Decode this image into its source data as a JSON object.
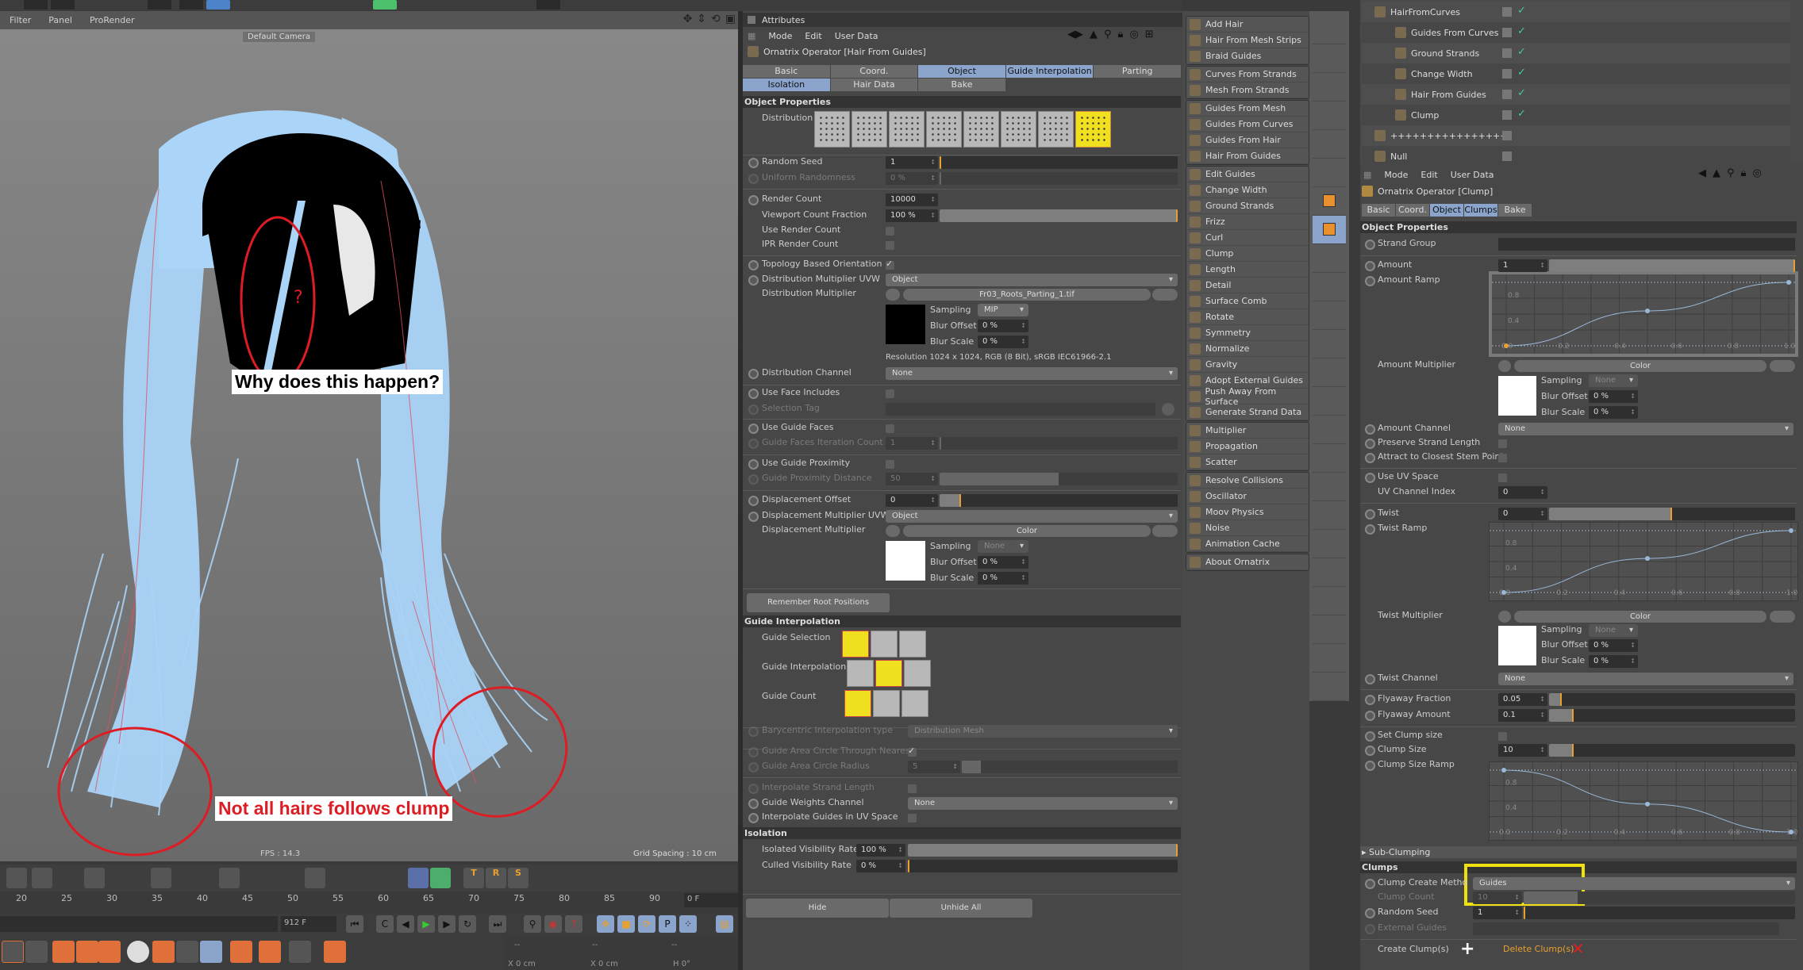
{
  "viewport": {
    "menu": [
      "Filter",
      "Panel",
      "ProRender"
    ],
    "camera_label": "Default Camera",
    "fps": "FPS : 14.3",
    "grid_spacing": "Grid Spacing : 10 cm",
    "annotation_top": "Why does this happen?",
    "annotation_bottom": "Not all hairs follows clump",
    "annotation_question": "?"
  },
  "timeline": {
    "ticks": [
      "20",
      "25",
      "30",
      "35",
      "40",
      "45",
      "50",
      "55",
      "60",
      "65",
      "70",
      "75",
      "80",
      "85",
      "90"
    ],
    "current_frame": "0 F",
    "end_frame": "912 F"
  },
  "coords": {
    "x1": "X  0 cm",
    "x2": "X  0 cm",
    "h": "H  0°",
    "dashes": "--"
  },
  "attributes_left": {
    "title": "Attributes",
    "menu": [
      "Mode",
      "Edit",
      "User Data"
    ],
    "operator": "Ornatrix Operator [Hair From Guides]",
    "tabs_row1": [
      {
        "label": "Basic",
        "active": false
      },
      {
        "label": "Coord.",
        "active": false
      },
      {
        "label": "Object",
        "active": true
      },
      {
        "label": "Guide Interpolation",
        "active": true
      },
      {
        "label": "Parting",
        "active": false
      }
    ],
    "tabs_row2": [
      {
        "label": "Isolation",
        "active": true
      },
      {
        "label": "Hair Data",
        "active": false
      },
      {
        "label": "Bake",
        "active": false
      }
    ],
    "section_object": "Object Properties",
    "distribution_label": "Distribution",
    "distribution_selected_index": 7,
    "random_seed": {
      "label": "Random Seed",
      "value": "1"
    },
    "uniform_randomness": {
      "label": "Uniform Randomness",
      "value": "0 %"
    },
    "render_count": {
      "label": "Render Count",
      "value": "10000"
    },
    "viewport_count_fraction": {
      "label": "Viewport Count Fraction",
      "value": "100 %",
      "fraction": 1.0
    },
    "use_render_count": {
      "label": "Use Render Count",
      "checked": false
    },
    "ipr_render_count": {
      "label": "IPR Render Count",
      "checked": false
    },
    "topology_orientation": {
      "label": "Topology Based Orientation",
      "checked": true
    },
    "dist_mult_uvw": {
      "label": "Distribution Multiplier UVW",
      "value": "Object"
    },
    "dist_mult": {
      "label": "Distribution Multiplier",
      "file": "Fr03_Roots_Parting_1.tif"
    },
    "dist_sampling": {
      "label": "Sampling",
      "value": "MIP"
    },
    "dist_blur_offset": {
      "label": "Blur Offset",
      "value": "0 %"
    },
    "dist_blur_scale": {
      "label": "Blur Scale",
      "value": "0 %"
    },
    "resolution": "Resolution 1024 x 1024, RGB (8 Bit), sRGB IEC61966-2.1",
    "dist_channel": {
      "label": "Distribution Channel",
      "value": "None"
    },
    "use_face_includes": {
      "label": "Use Face Includes",
      "checked": false
    },
    "selection_tag": {
      "label": "Selection Tag"
    },
    "use_guide_faces": {
      "label": "Use Guide Faces",
      "checked": false
    },
    "guide_faces_iter": {
      "label": "Guide Faces Iteration Count",
      "value": "1"
    },
    "use_guide_proximity": {
      "label": "Use Guide Proximity",
      "checked": false
    },
    "guide_proximity_distance": {
      "label": "Guide Proximity Distance",
      "value": "50",
      "fraction": 0.5
    },
    "displacement_offset": {
      "label": "Displacement Offset",
      "value": "0",
      "fraction": 0.09
    },
    "disp_mult_uvw": {
      "label": "Displacement Multiplier UVW",
      "value": "Object"
    },
    "disp_mult": {
      "label": "Displacement Multiplier",
      "value": "Color"
    },
    "disp_sampling": {
      "label": "Sampling",
      "value": "None"
    },
    "disp_blur_offset": {
      "label": "Blur Offset",
      "value": "0 %"
    },
    "disp_blur_scale": {
      "label": "Blur Scale",
      "value": "0 %"
    },
    "remember_roots": "Remember Root Positions",
    "section_guide_interp": "Guide Interpolation",
    "guide_selection": "Guide Selection",
    "guide_interpolation": "Guide Interpolation",
    "guide_count": "Guide Count",
    "barycentric": {
      "label": "Barycentric Interpolation type",
      "value": "Distribution Mesh"
    },
    "area_circle_nearest": {
      "label": "Guide Area Circle Through Nearest",
      "checked": true
    },
    "area_circle_radius": {
      "label": "Guide Area Circle Radius",
      "value": "5",
      "fraction": 0.09
    },
    "interp_strand_length": {
      "label": "Interpolate Strand Length",
      "checked": false
    },
    "guide_weights_channel": {
      "label": "Guide Weights Channel",
      "value": "None"
    },
    "interp_uv_space": {
      "label": "Interpolate Guides in UV Space",
      "checked": false
    },
    "section_isolation": "Isolation",
    "isolated_vis_rate": {
      "label": "Isolated Visibility Rate",
      "value": "100 %",
      "fraction": 1.0
    },
    "culled_vis_rate": {
      "label": "Culled Visibility Rate",
      "value": "0 %",
      "fraction": 0.0
    },
    "hide": "Hide",
    "unhide_all": "Unhide All"
  },
  "plugin_menu": {
    "groups": [
      [
        "Add Hair",
        "Hair From Mesh Strips",
        "Braid Guides"
      ],
      [
        "Curves From Strands",
        "Mesh From Strands"
      ],
      [
        "Guides From Mesh",
        "Guides From Curves",
        "Guides From Hair",
        "Hair From Guides"
      ],
      [
        "Edit Guides",
        "Change Width",
        "Ground Strands",
        "Frizz",
        "Curl",
        "Clump",
        "Length",
        "Detail",
        "Surface Comb",
        "Rotate",
        "Symmetry",
        "Normalize",
        "Gravity",
        "Adopt External Guides",
        "Push Away From Surface",
        "Generate Strand Data"
      ],
      [
        "Multiplier",
        "Propagation",
        "Scatter"
      ],
      [
        "Resolve Collisions",
        "Oscillator",
        "Moov Physics",
        "Noise",
        "Animation Cache"
      ],
      [
        "About Ornatrix"
      ]
    ]
  },
  "object_manager": {
    "items": [
      {
        "name": "HairFromCurves",
        "level": 0
      },
      {
        "name": "Guides From Curves",
        "level": 1
      },
      {
        "name": "Ground Strands",
        "level": 1
      },
      {
        "name": "Change Width",
        "level": 1
      },
      {
        "name": "Hair From Guides",
        "level": 1
      },
      {
        "name": "Clump",
        "level": 1
      },
      {
        "name": "++++++++++++++++",
        "level": 0
      },
      {
        "name": "Null",
        "level": 0
      }
    ]
  },
  "attributes_right": {
    "menu": [
      "Mode",
      "Edit",
      "User Data"
    ],
    "operator": "Ornatrix Operator [Clump]",
    "tabs": [
      {
        "label": "Basic",
        "active": false
      },
      {
        "label": "Coord.",
        "active": false
      },
      {
        "label": "Object",
        "active": true
      },
      {
        "label": "Clumps",
        "active": true
      },
      {
        "label": "Bake",
        "active": false
      }
    ],
    "section_object": "Object Properties",
    "strand_group": {
      "label": "Strand Group"
    },
    "amount": {
      "label": "Amount",
      "value": "1",
      "fraction": 1.0
    },
    "amount_ramp": {
      "label": "Amount Ramp"
    },
    "ramp_ticks_x": [
      "0.0",
      "0.2",
      "0.4",
      "0.6",
      "0.8",
      "1.0"
    ],
    "ramp_ticks_y": [
      "0.8",
      "0.4"
    ],
    "amount_ramp_points": [
      [
        0.0,
        0.0
      ],
      [
        0.5,
        0.55
      ],
      [
        1.0,
        1.0
      ]
    ],
    "amount_mult": {
      "label": "Amount Multiplier",
      "value": "Color"
    },
    "amount_sampling": {
      "label": "Sampling",
      "value": "None"
    },
    "amount_blur_offset": {
      "label": "Blur Offset",
      "value": "0 %"
    },
    "amount_blur_scale": {
      "label": "Blur Scale",
      "value": "0 %"
    },
    "amount_channel": {
      "label": "Amount Channel",
      "value": "None"
    },
    "preserve_length": {
      "label": "Preserve Strand Length",
      "checked": false
    },
    "attract_stem": {
      "label": "Attract to Closest Stem Point",
      "checked": false
    },
    "use_uv_space": {
      "label": "Use UV Space",
      "checked": false
    },
    "uv_channel_index": {
      "label": "UV Channel Index",
      "value": "0"
    },
    "twist": {
      "label": "Twist",
      "value": "0",
      "fraction": 0.5
    },
    "twist_ramp": {
      "label": "Twist Ramp"
    },
    "twist_ramp_points": [
      [
        0.0,
        0.0
      ],
      [
        0.5,
        0.55
      ],
      [
        1.0,
        1.0
      ]
    ],
    "twist_mult": {
      "label": "Twist Multiplier",
      "value": "Color"
    },
    "twist_sampling": {
      "label": "Sampling",
      "value": "None"
    },
    "twist_blur_offset": {
      "label": "Blur Offset",
      "value": "0 %"
    },
    "twist_blur_scale": {
      "label": "Blur Scale",
      "value": "0 %"
    },
    "twist_channel": {
      "label": "Twist Channel",
      "value": "None"
    },
    "flyaway_fraction": {
      "label": "Flyaway Fraction",
      "value": "0.05",
      "fraction": 0.05
    },
    "flyaway_amount": {
      "label": "Flyaway Amount",
      "value": "0.1",
      "fraction": 0.1
    },
    "set_clump_size": {
      "label": "Set Clump size",
      "checked": false
    },
    "clump_size": {
      "label": "Clump Size",
      "value": "10",
      "fraction": 0.1
    },
    "clump_size_ramp": {
      "label": "Clump Size Ramp"
    },
    "clump_size_ramp_points": [
      [
        0.0,
        1.0
      ],
      [
        0.5,
        0.45
      ],
      [
        1.0,
        0.0
      ]
    ],
    "sub_clumping": "Sub-Clumping",
    "section_clumps": "Clumps",
    "clump_create_method": {
      "label": "Clump Create Metho",
      "value": "Guides"
    },
    "clump_count": {
      "label": "Clump Count",
      "value": "10",
      "fraction": 0.2
    },
    "random_seed": {
      "label": "Random Seed",
      "value": "1",
      "fraction": 0.0
    },
    "external_guides": {
      "label": "External Guides"
    },
    "create_clumps": "Create Clump(s)",
    "delete_clumps": "Delete Clump(s)"
  },
  "colors": {
    "highlight": "#f0e010",
    "annotation_red": "#dd1c24",
    "tab_active": "#8aa4cc",
    "hair": "#aad4f8",
    "accent_orange": "#e8a030"
  }
}
